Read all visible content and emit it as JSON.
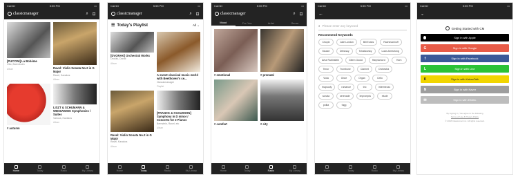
{
  "status": {
    "carrier": "Carrier",
    "time": "5:55 PM"
  },
  "app": {
    "logo_text": "classicmanager"
  },
  "tabs": [
    "Home",
    "Today",
    "Radio",
    "Search",
    "My Library"
  ],
  "screen1": {
    "cards": [
      {
        "title": "[PUCCINI] La Bohème",
        "subtitle": "Otto, Barenboim",
        "type": "Album"
      },
      {
        "title": "Ravel: Violin Sonata No.2 in G Major",
        "subtitle": "Ravel, Kavakos",
        "type": "Album"
      },
      {
        "title": "# autumn",
        "subtitle": "",
        "type": ""
      },
      {
        "title": "LISZT & SCHUMANN & WIENIAWSKI Symphonies / Suites",
        "subtitle": "Various, Kavakos",
        "type": "Album"
      }
    ]
  },
  "screen2": {
    "title": "Today's Playlist",
    "filter": "All",
    "cards": [
      {
        "title": "[DVORAK] Orchestral Works",
        "subtitle": "Dvořák, Dorati",
        "type": "Album"
      },
      {
        "title": "A sweet classical music world with Beethoven's ce...",
        "subtitle": "Classicmanager",
        "type": "Playlist"
      },
      {
        "title": "Ravel: Violin Sonata No.2 in G Major",
        "subtitle": "Ravel, Kavakos",
        "type": "Album"
      },
      {
        "title": "[FRANCK & CHAUSSON] Symphony in D minor / Concerto for 2 Pianos",
        "subtitle": "Bernstein, Ravel, etc",
        "type": "Album"
      }
    ]
  },
  "screen3": {
    "segments": [
      "Mood",
      "For You",
      "Artist",
      "Genre"
    ],
    "active_segment": "Mood",
    "cards": [
      {
        "title": "# emotional"
      },
      {
        "title": "# prenatal"
      },
      {
        "title": "# comfort"
      },
      {
        "title": "# city"
      }
    ]
  },
  "screen4": {
    "search_placeholder": "Please enter any keyword",
    "section_title": "Recommend Keywords",
    "keywords": [
      "Chopin",
      "Julie London",
      "Bill Evans",
      "Rachmaninoff",
      "Mozart",
      "Debussy",
      "Tchaikovsky",
      "Louis Armstrong",
      "Artur Rubinstein",
      "Glenn Gould",
      "Harpsichord",
      "Horn",
      "Tenor",
      "Trombone",
      "Clarinet",
      "Orchestra",
      "Viola",
      "Oboe",
      "Organ",
      "Cello",
      "rhapsody",
      "romance",
      "trio",
      "intermezzo",
      "sonata",
      "serenade",
      "impromptu",
      "etude",
      "polka",
      "fugg"
    ]
  },
  "screen5": {
    "heading": "Getting Started with CM",
    "buttons": [
      {
        "label": "Sign in with Apple",
        "color": "#000000",
        "icon": "apple-icon",
        "glyph": ""
      },
      {
        "label": "Sign in with Google",
        "color": "#e85b47",
        "icon": "google-icon",
        "glyph": "G"
      },
      {
        "label": "Sign in with Facebook",
        "color": "#3b5998",
        "icon": "facebook-icon",
        "glyph": "f"
      },
      {
        "label": "Sign in with Line",
        "color": "#2bc236",
        "icon": "line-icon",
        "glyph": "L"
      },
      {
        "label": "Sign in with KakaoTalk",
        "color": "#f1d500",
        "icon": "kakaotalk-icon",
        "glyph": "K"
      },
      {
        "label": "Sign in with Naver",
        "color": "#9e9e9e",
        "icon": "naver-icon",
        "glyph": "N"
      },
      {
        "label": "Sign in with EMAIL",
        "color": "#bdbdbd",
        "icon": "email-icon",
        "glyph": "✉"
      }
    ],
    "terms_line1": "By signing in, You agree to the following",
    "terms_line2": "Terms of Use & Privacy Policy",
    "copyright": "© 2018 Classicman Inc. All rights reserved."
  },
  "colors": {
    "dark": "#232323",
    "apple": "#000000",
    "google": "#e85b47",
    "facebook": "#3b5998",
    "line": "#2bc236",
    "kakao": "#f1d500",
    "naver": "#9e9e9e"
  }
}
